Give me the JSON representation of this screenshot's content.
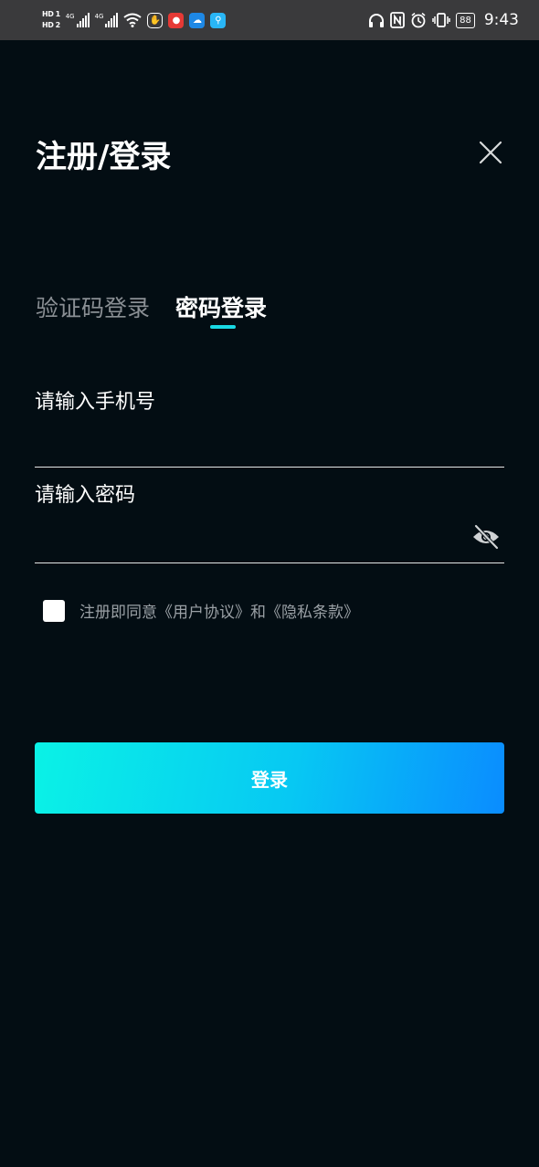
{
  "status_bar": {
    "hd1": "HD 1",
    "hd2": "HD 2",
    "net1": "4G",
    "net2": "4G",
    "battery": "88",
    "time": "9:43"
  },
  "header": {
    "title": "注册/登录",
    "close_icon": "close-icon"
  },
  "tabs": [
    {
      "label": "验证码登录",
      "active": false
    },
    {
      "label": "密码登录",
      "active": true
    }
  ],
  "form": {
    "phone_placeholder": "请输入手机号",
    "password_placeholder": "请输入密码",
    "password_visibility_icon": "eye-off-icon"
  },
  "agreement": {
    "prefix": "注册即同意《",
    "user_agreement": " 用户协议 ",
    "middle": "》和《",
    "privacy_policy": "隐私条款",
    "suffix": " 》"
  },
  "login_button": {
    "label": "登录"
  },
  "colors": {
    "background": "#030d13",
    "accent": "#19d9e4",
    "button_gradient_start": "#0af2e6",
    "button_gradient_end": "#0a8cff"
  }
}
